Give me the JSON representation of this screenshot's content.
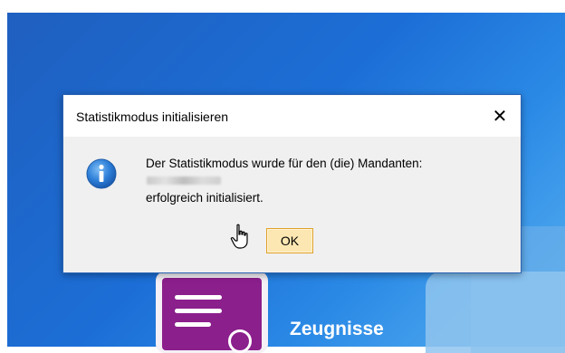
{
  "dialog": {
    "title": "Statistikmodus initialisieren",
    "close_glyph": "✕",
    "icon": "info-icon",
    "message_line1": "Der Statistikmodus wurde für den (die) Mandanten:",
    "message_line3": "erfolgreich initialisiert.",
    "ok_label": "OK"
  },
  "background": {
    "tile_label": "Zeugnisse",
    "tile_icon": "document-icon"
  },
  "colors": {
    "dialog_border": "#2b64b4",
    "ok_button_bg": "#fce7b2",
    "tile_purple": "#8b1f8c"
  }
}
